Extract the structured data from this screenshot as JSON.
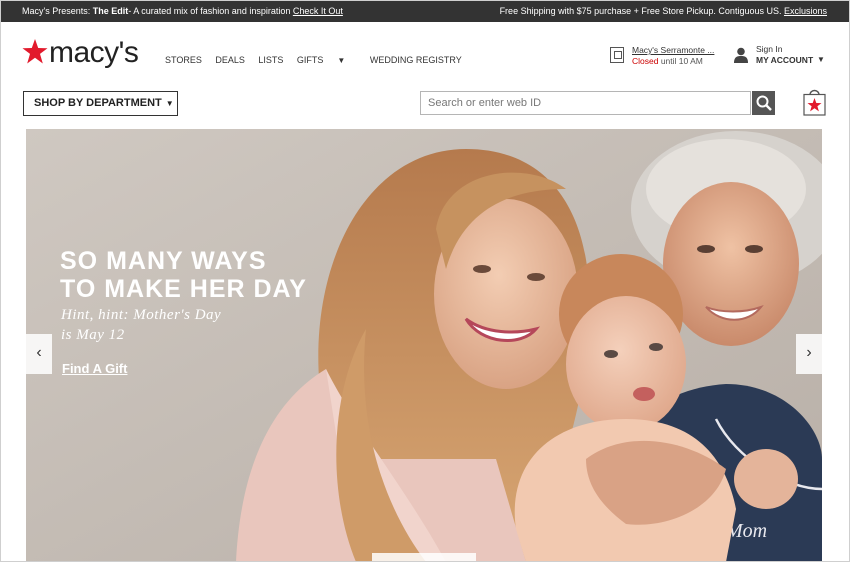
{
  "promo": {
    "left_prefix": "Macy's Presents: ",
    "left_bold": "The Edit",
    "left_text": "- A curated mix of fashion and inspiration ",
    "left_link": "Check It Out",
    "right_text": "Free Shipping with $75 purchase + Free Store Pickup. Contiguous US. ",
    "right_link": "Exclusions"
  },
  "header": {
    "logo_text": "macy's",
    "nav": [
      "STORES",
      "DEALS",
      "LISTS",
      "GIFTS",
      "WEDDING REGISTRY"
    ],
    "store_name": "Macy's Serramonte ...",
    "store_closed": "Closed",
    "store_hours": " until 10 AM",
    "signin": "Sign In",
    "my_account": "MY ACCOUNT",
    "dept_label": "SHOP BY DEPARTMENT",
    "search_placeholder": "Search or enter web ID"
  },
  "hero": {
    "headline_line1": "SO MANY WAYS",
    "headline_line2": "TO MAKE HER DAY",
    "sub_line1": "Hint, hint: Mother's Day",
    "sub_line2": "is May 12",
    "cta": "Find A Gift",
    "shirt_text": "Mom",
    "prev": "‹",
    "next": "›"
  },
  "colors": {
    "brand_red": "#e21a2c",
    "promo_bg": "#333333",
    "search_btn": "#555555"
  },
  "icons": [
    "star-logo-icon",
    "store-icon",
    "person-icon",
    "search-icon",
    "bag-icon",
    "chevron-left-icon",
    "chevron-right-icon"
  ]
}
